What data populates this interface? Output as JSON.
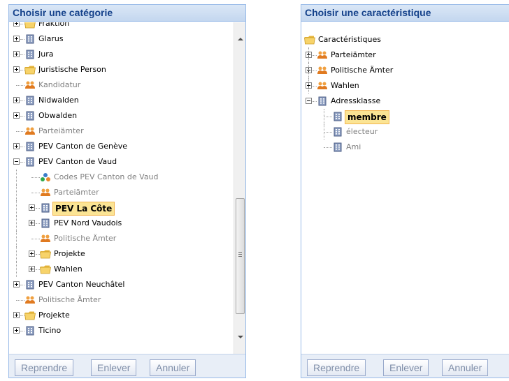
{
  "left_panel": {
    "title": "Choisir une catégorie",
    "items": [
      {
        "label": "Fraktion",
        "icon": "folder-icon"
      },
      {
        "label": "Glarus",
        "icon": "building-icon"
      },
      {
        "label": "Jura",
        "icon": "building-icon"
      },
      {
        "label": "Juristische Person",
        "icon": "folder-icon"
      },
      {
        "label": "Kandidatur",
        "icon": "group-icon"
      },
      {
        "label": "Nidwalden",
        "icon": "building-icon"
      },
      {
        "label": "Obwalden",
        "icon": "building-icon"
      },
      {
        "label": "Parteiämter",
        "icon": "group-icon"
      },
      {
        "label": "PEV Canton de Genève",
        "icon": "building-icon"
      },
      {
        "label": "PEV Canton de Vaud",
        "icon": "building-icon"
      },
      {
        "label": "Codes PEV Canton de Vaud",
        "icon": "codes-icon"
      },
      {
        "label": "Parteiämter",
        "icon": "group-icon"
      },
      {
        "label": "PEV La Côte",
        "icon": "building-icon"
      },
      {
        "label": "PEV Nord Vaudois",
        "icon": "building-icon"
      },
      {
        "label": "Politische Ämter",
        "icon": "group-icon"
      },
      {
        "label": "Projekte",
        "icon": "folder-icon"
      },
      {
        "label": "Wahlen",
        "icon": "folder-icon"
      },
      {
        "label": "PEV Canton Neuchâtel",
        "icon": "building-icon"
      },
      {
        "label": "Politische Ämter",
        "icon": "group-icon"
      },
      {
        "label": "Projekte",
        "icon": "folder-icon"
      },
      {
        "label": "Ticino",
        "icon": "building-icon"
      }
    ],
    "buttons": {
      "take": "Reprendre",
      "remove": "Enlever",
      "cancel": "Annuler"
    }
  },
  "right_panel": {
    "title": "Choisir une caractéristique",
    "items": [
      {
        "label": "Caractéristiques",
        "icon": "folder-icon"
      },
      {
        "label": "Parteiämter",
        "icon": "group-icon"
      },
      {
        "label": "Politische Ämter",
        "icon": "group-icon"
      },
      {
        "label": "Wahlen",
        "icon": "group-icon"
      },
      {
        "label": "Adressklasse",
        "icon": "building-icon"
      },
      {
        "label": "membre",
        "icon": "building-icon"
      },
      {
        "label": "électeur",
        "icon": "building-icon"
      },
      {
        "label": "Ami",
        "icon": "building-icon"
      }
    ],
    "buttons": {
      "take": "Reprendre",
      "remove": "Enlever",
      "cancel": "Annuler"
    }
  },
  "colors": {
    "header_text": "#15428b",
    "selection_bg": "#fbe494",
    "selection_border": "#f3b54f",
    "folder": "#f5c542",
    "building": "#5a6e96",
    "group_orange": "#e8882a",
    "group_blue": "#3a7cc8"
  }
}
